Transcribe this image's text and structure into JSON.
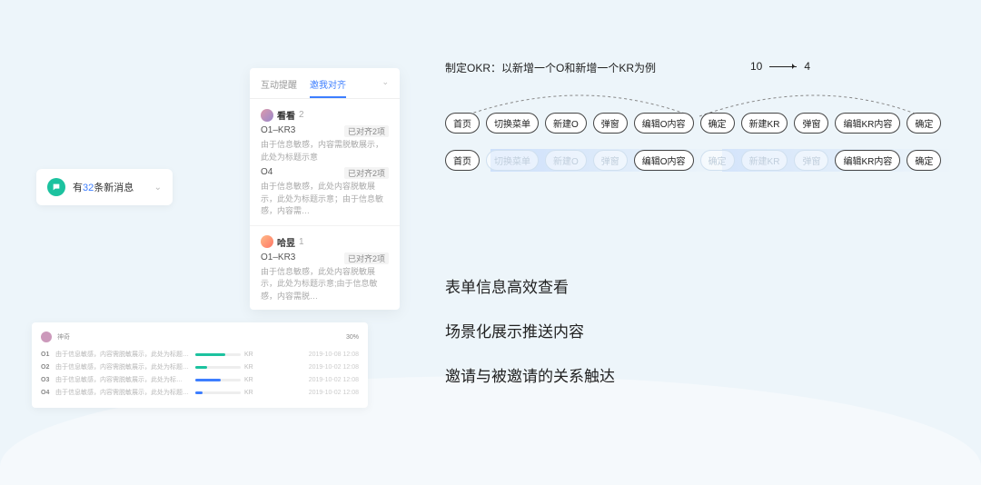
{
  "notification": {
    "prefix": "有",
    "count": "32",
    "suffix": "条新消息"
  },
  "messages": {
    "tabs": [
      "互动提醒",
      "邀我对齐"
    ],
    "items": [
      {
        "name": "看看",
        "count": "2",
        "subs": [
          {
            "id": "O1–KR3",
            "badge": "已对齐2项",
            "body": "由于信息敏感，内容需脱敏展示，此处为标题示意"
          },
          {
            "id": "O4",
            "badge": "已对齐2项",
            "body": "由于信息敏感，此处内容脱敏展示，此处为标题示意；由于信息敏感，内容需…"
          }
        ]
      },
      {
        "name": "哈昱",
        "count": "1",
        "subs": [
          {
            "id": "O1–KR3",
            "badge": "已对齐2项",
            "body": "由于信息敏感，此处内容脱敏展示，此处为标题示意;由于信息敏感，内容需脱…"
          }
        ]
      }
    ]
  },
  "list": {
    "owner": "神奇",
    "pct": "30%",
    "rows": [
      {
        "idx": "O1",
        "txt": "由于信息敏感，内容需脱敏展示，此处为标题示意…",
        "kr": "KR",
        "date": "2019-10-08 12:08"
      },
      {
        "idx": "O2",
        "txt": "由于信息敏感，内容需脱敏展示，此处为标题示意;此…",
        "kr": "KR",
        "date": "2019-10-02 12:08"
      },
      {
        "idx": "O3",
        "txt": "由于信息敏感，内容需脱敏展示，此处为标…",
        "kr": "KR",
        "date": "2019-10-02 12:08"
      },
      {
        "idx": "O4",
        "txt": "由于信息敏感，内容需脱敏展示，此处为标题示意…",
        "kr": "KR",
        "date": "2019-10-02 12:08"
      }
    ]
  },
  "flow": {
    "title": "制定OKR：以新增一个O和新增一个KR为例",
    "a": "10",
    "b": "4",
    "row1": [
      "首页",
      "切换菜单",
      "新建O",
      "弹窗",
      "编辑O内容",
      "确定",
      "新建KR",
      "弹窗",
      "编辑KR内容",
      "确定"
    ],
    "row2": [
      "首页",
      "切换菜单",
      "新建O",
      "弹窗",
      "编辑O内容",
      "确定",
      "新建KR",
      "弹窗",
      "编辑KR内容",
      "确定"
    ]
  },
  "captions": {
    "c1": "表单信息高效查看",
    "c2": "场景化展示推送内容",
    "c3": "邀请与被邀请的关系触达"
  }
}
